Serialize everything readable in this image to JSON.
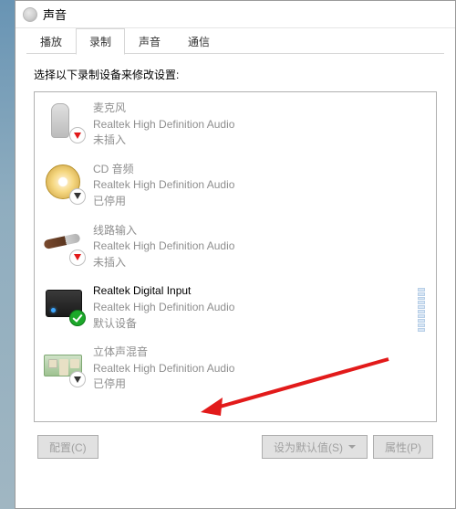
{
  "window": {
    "title": "声音"
  },
  "tabs": [
    {
      "label": "播放",
      "active": false
    },
    {
      "label": "录制",
      "active": true
    },
    {
      "label": "声音",
      "active": false
    },
    {
      "label": "通信",
      "active": false
    }
  ],
  "instruction": "选择以下录制设备来修改设置:",
  "devices": [
    {
      "name": "麦克风",
      "desc": "Realtek High Definition Audio",
      "status": "未插入",
      "badge": "red",
      "icon_name": "microphone-icon",
      "dim": true
    },
    {
      "name": "CD 音频",
      "desc": "Realtek High Definition Audio",
      "status": "已停用",
      "badge": "down",
      "icon_name": "cd-icon",
      "dim": true
    },
    {
      "name": "线路输入",
      "desc": "Realtek High Definition Audio",
      "status": "未插入",
      "badge": "red",
      "icon_name": "line-in-icon",
      "dim": true
    },
    {
      "name": "Realtek Digital Input",
      "desc": "Realtek High Definition Audio",
      "status": "默认设备",
      "badge": "green",
      "icon_name": "digital-input-icon",
      "dim": false,
      "meter": true
    },
    {
      "name": "立体声混音",
      "desc": "Realtek High Definition Audio",
      "status": "已停用",
      "badge": "down",
      "icon_name": "stereo-mix-icon",
      "dim": true
    }
  ],
  "buttons": {
    "configure": "配置(C)",
    "set_default": "设为默认值(S)",
    "properties": "属性(P)"
  },
  "annotation": {
    "arrow_color": "#e21a1a"
  }
}
